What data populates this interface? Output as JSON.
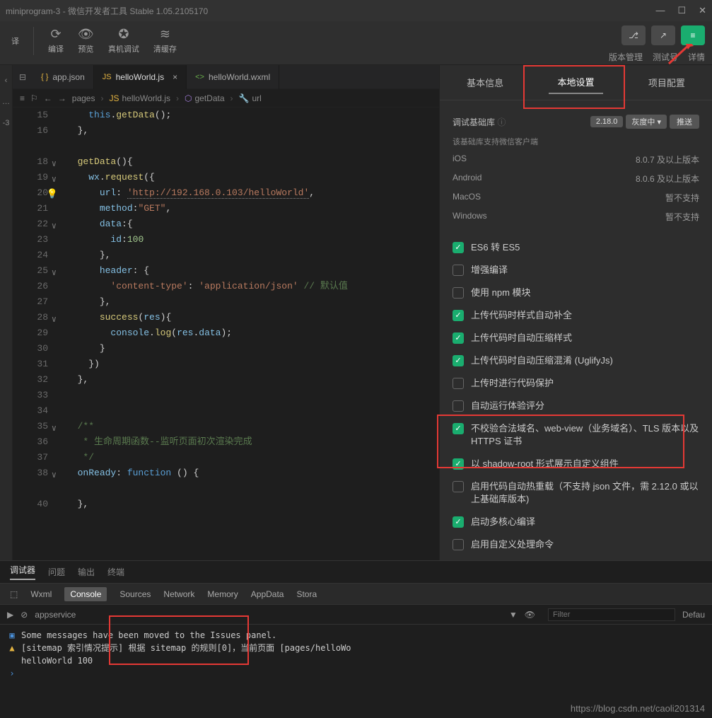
{
  "titlebar": {
    "title": "miniprogram-3 - 微信开发者工具 Stable 1.05.2105170"
  },
  "toolbar": {
    "dropdown": "译",
    "actions": [
      "编译",
      "预览",
      "真机调试",
      "清缓存"
    ],
    "right_labels": [
      "版本管理",
      "测试号",
      "详情"
    ]
  },
  "left_sidebar": {
    "item": "-3"
  },
  "editor": {
    "tabs": [
      {
        "icon": "{ }",
        "name": "app.json",
        "active": false
      },
      {
        "icon": "JS",
        "name": "helloWorld.js",
        "active": true
      },
      {
        "icon": "<>",
        "name": "helloWorld.wxml",
        "active": false
      }
    ],
    "breadcrumbs": [
      "pages",
      "helloWorld.js",
      "getData",
      "url"
    ],
    "lines": {
      "15": "this.getData();",
      "16": "},",
      "18_fn": "getData",
      "18_rest": "(){",
      "19_obj": "wx",
      "19_fn": "request",
      "19_rest": "({",
      "20_key": "url",
      "20_val": "'http://192.168.0.103/helloWorld'",
      "21_key": "method",
      "21_val": "\"GET\"",
      "22_key": "data",
      "22_rest": ":{",
      "23_key": "id",
      "23_val": "100",
      "24": "},",
      "25_key": "header",
      "25_rest": ": {",
      "26_key": "'content-type'",
      "26_val": "'application/json'",
      "26_comm": " // 默认值",
      "27": "},",
      "28_fn": "success",
      "28_arg": "res",
      "28_rest": "){",
      "29": "console.log(res.data);",
      "30": "}",
      "31": "})",
      "32": "},",
      "35": "/**",
      "36": " * 生命周期函数--监听页面初次渲染完成",
      "37": " */",
      "38_key": "onReady",
      "38_fn": "function",
      "38_rest": " () {",
      "40": "},"
    }
  },
  "rightpanel": {
    "tabs": [
      "基本信息",
      "本地设置",
      "项目配置"
    ],
    "active_tab": 1,
    "debug_lib_label": "调试基础库",
    "debug_lib_version": "2.18.0",
    "debug_lib_gray": "灰度中 ▾",
    "debug_lib_push": "推送",
    "debug_lib_note": "该基础库支持微信客户端",
    "kv": [
      {
        "k": "iOS",
        "v": "8.0.7 及以上版本"
      },
      {
        "k": "Android",
        "v": "8.0.6 及以上版本"
      },
      {
        "k": "MacOS",
        "v": "暂不支持"
      },
      {
        "k": "Windows",
        "v": "暂不支持"
      }
    ],
    "checks": [
      {
        "label": "ES6 转 ES5",
        "checked": true
      },
      {
        "label": "增强编译",
        "checked": false
      },
      {
        "label": "使用 npm 模块",
        "checked": false
      },
      {
        "label": "上传代码时样式自动补全",
        "checked": true
      },
      {
        "label": "上传代码时自动压缩样式",
        "checked": true
      },
      {
        "label": "上传代码时自动压缩混淆  (UglifyJs)",
        "checked": true
      },
      {
        "label": "上传时进行代码保护",
        "checked": false
      },
      {
        "label": "自动运行体验评分",
        "checked": false
      },
      {
        "label": "不校验合法域名、web-view（业务域名）、TLS 版本以及 HTTPS 证书",
        "checked": true
      },
      {
        "label": "以 shadow-root 形式展示自定义组件",
        "checked": true
      },
      {
        "label": "启用代码自动热重载（不支持 json 文件，需 2.12.0 或以上基础库版本)",
        "checked": false
      },
      {
        "label": "启动多核心编译",
        "checked": true
      },
      {
        "label": "启用自定义处理命令",
        "checked": false
      }
    ]
  },
  "bottom": {
    "tabs": [
      "调试器",
      "问题",
      "输出",
      "终端"
    ],
    "devtools_tabs": [
      "Wxml",
      "Console",
      "Sources",
      "Network",
      "Memory",
      "AppData",
      "Stora"
    ],
    "active_dtab": 1,
    "context": "appservice",
    "filter_placeholder": "Filter",
    "default_label": "Defau",
    "msg_issues": "Some messages have been moved to the Issues panel.",
    "msg_sitemap": "[sitemap 索引情况提示] 根据 sitemap 的规则[0]，当前页面 [pages/helloWo",
    "msg_hello": "helloWorld 100"
  },
  "watermark": "https://blog.csdn.net/caoli201314"
}
